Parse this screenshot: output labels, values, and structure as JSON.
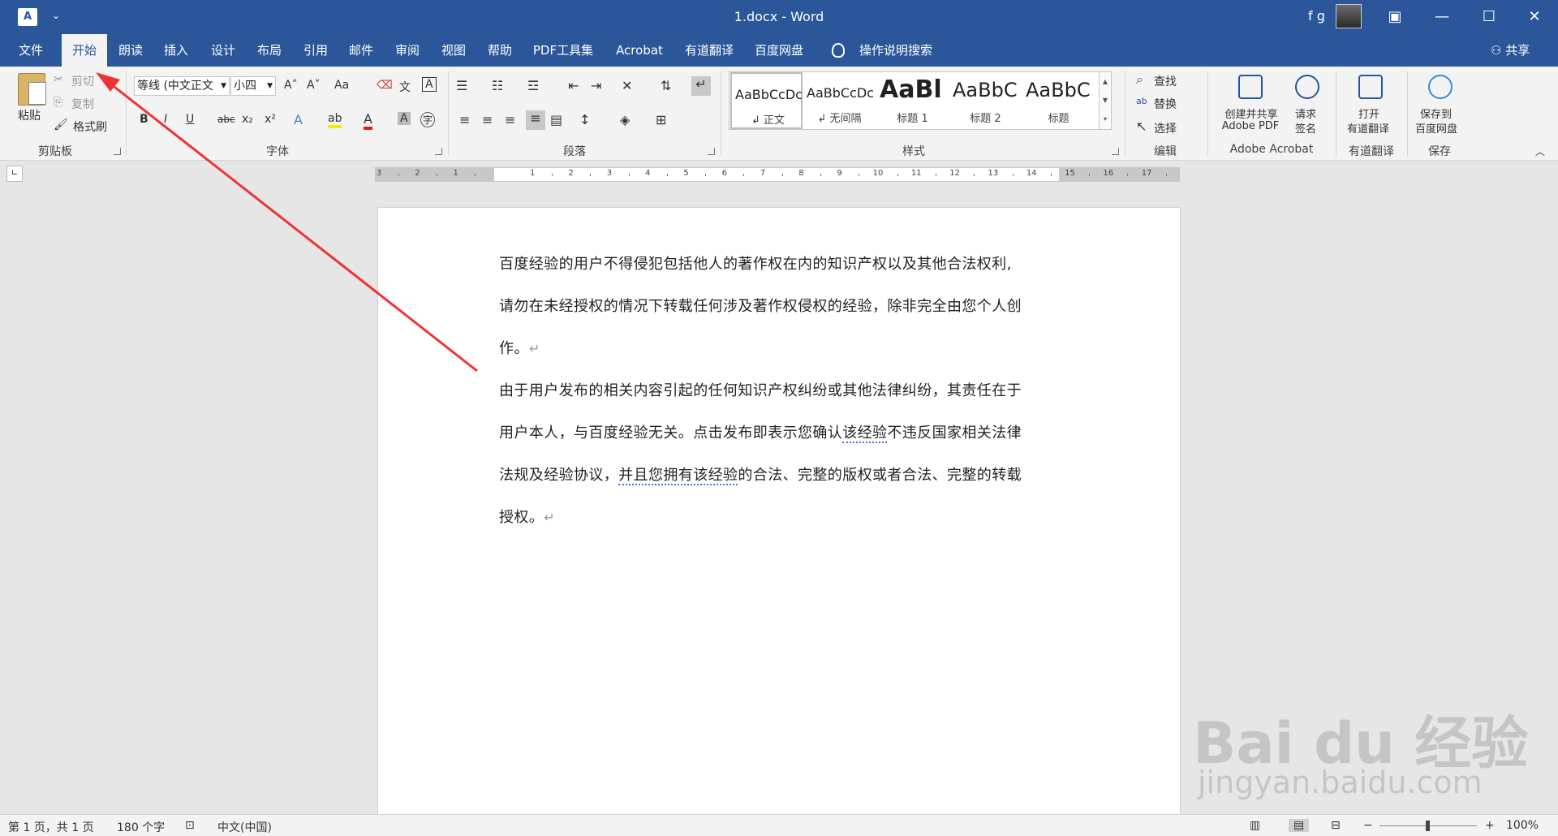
{
  "window": {
    "title": "1.docx  -  Word",
    "user": "f g",
    "qat_symbol": "⌄",
    "controls": [
      "▣",
      "—",
      "☐",
      "✕"
    ]
  },
  "tabs": [
    "文件",
    "开始",
    "朗读",
    "插入",
    "设计",
    "布局",
    "引用",
    "邮件",
    "审阅",
    "视图",
    "帮助",
    "PDF工具集",
    "Acrobat",
    "有道翻译",
    "百度网盘"
  ],
  "active_tab": "开始",
  "tell_me": "操作说明搜索",
  "share": "共享",
  "ribbon": {
    "clipboard": {
      "label": "剪贴板",
      "paste": "粘贴",
      "cut": "剪切",
      "copy": "复制",
      "format_painter": "格式刷"
    },
    "font": {
      "label": "字体",
      "font_name": "等线 (中文正文",
      "font_size": "小四",
      "bold": "B",
      "italic": "I",
      "underline": "U",
      "strike": "abc",
      "subscript": "x₂",
      "superscript": "x²",
      "grow": "A˄",
      "shrink": "A˅",
      "change_case": "Aa",
      "phonetic": "文",
      "char_border": "A",
      "text_effect": "A",
      "highlight": "ab",
      "font_color": "A",
      "char_shading": "A",
      "enclose": "字"
    },
    "paragraph": {
      "label": "段落"
    },
    "styles": {
      "label": "样式",
      "items": [
        {
          "sample": "AaBbCcDc",
          "name": "↲ 正文"
        },
        {
          "sample": "AaBbCcDc",
          "name": "↲ 无间隔"
        },
        {
          "sample": "AaBl",
          "name": "标题 1"
        },
        {
          "sample": "AaBbC",
          "name": "标题 2"
        },
        {
          "sample": "AaBbC",
          "name": "标题"
        }
      ]
    },
    "editing": {
      "label": "编辑",
      "find": "查找",
      "replace": "替换",
      "select": "选择"
    },
    "acrobat": {
      "label": "Adobe Acrobat",
      "create_share_1": "创建并共享",
      "create_share_2": "Adobe PDF",
      "request_sign_1": "请求",
      "request_sign_2": "签名"
    },
    "youdao": {
      "label": "有道翻译",
      "open_1": "打开",
      "open_2": "有道翻译"
    },
    "save": {
      "label": "保存",
      "save_1": "保存到",
      "save_2": "百度网盘"
    }
  },
  "ruler": {
    "labels": [
      "3",
      "2",
      "1",
      "1",
      "2",
      "3",
      "4",
      "5",
      "6",
      "7",
      "8",
      "9",
      "10",
      "11",
      "12",
      "13",
      "14",
      "15",
      "16",
      "17"
    ]
  },
  "document": {
    "lines": [
      "百度经验的用户不得侵犯包括他人的著作权在内的知识产权以及其他合法权利,",
      "请勿在未经授权的情况下转载任何涉及著作权侵权的经验，除非完全由您个人创",
      "作。",
      "由于用户发布的相关内容引起的任何知识产权纠纷或其他法律纠纷，其责任在于",
      "用户本人，与百度经验无关。点击发布即表示您确认",
      "该经验",
      "不违反国家相关法律",
      "法规及经验协议，",
      "并且您拥有该经验",
      "的合法、完整的版权或者合法、完整的转载",
      "授权。"
    ],
    "pilcrow": "↵"
  },
  "status": {
    "page": "第 1 页，共 1 页",
    "words": "180 个字",
    "language": "中文(中国)",
    "zoom": "100%",
    "zoom_minus": "−",
    "zoom_plus": "+"
  },
  "watermark": {
    "main": "Bai du 经验",
    "sub": "jingyan.baidu.com"
  },
  "colors": {
    "brand": "#2b579a",
    "annotation_arrow": "#ee3333"
  }
}
